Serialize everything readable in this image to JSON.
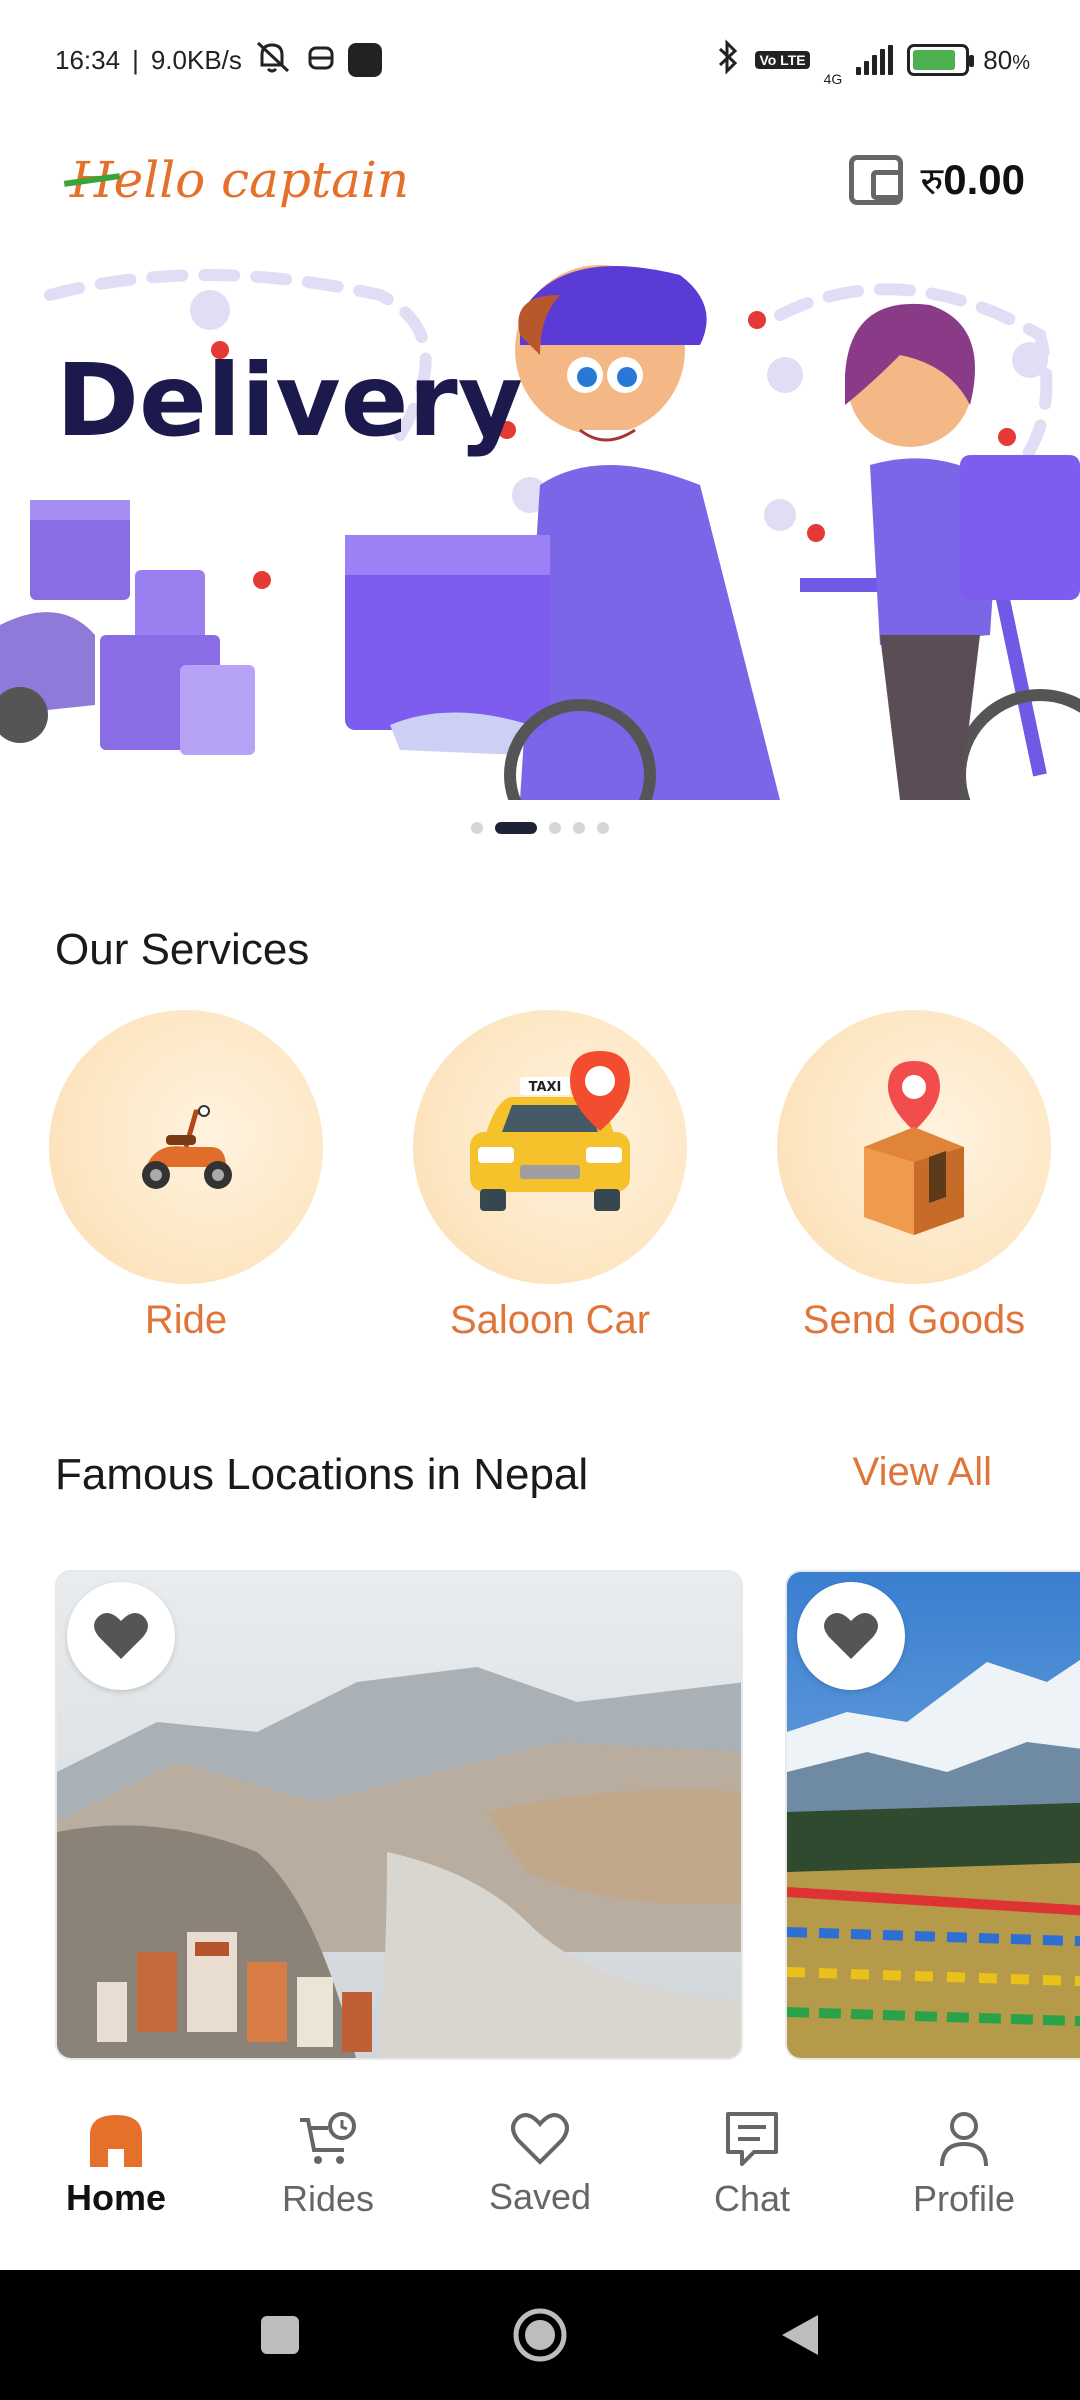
{
  "status_bar": {
    "time": "16:34",
    "net_speed": "9.0KB/s",
    "battery": "80",
    "network_type": "4G",
    "volte_label": "Vo LTE"
  },
  "header": {
    "logo_first": "H",
    "logo_rest": "ello captain",
    "currency": "रु",
    "wallet_amount": "0.00",
    "brand_color": "#e5702a"
  },
  "banner": {
    "headline": "Delivery",
    "active_index": 1,
    "slides": 5
  },
  "services": {
    "title": "Our Services",
    "items": [
      {
        "label": "Ride",
        "icon": "scooter-icon"
      },
      {
        "label": "Saloon Car",
        "icon": "taxi-icon"
      },
      {
        "label": "Send Goods",
        "icon": "parcel-icon"
      }
    ]
  },
  "locations": {
    "title": "Famous Locations in Nepal",
    "view_all": "View All",
    "cards": [
      {
        "image": "mustang-stupas",
        "favorite_icon": "heart-icon"
      },
      {
        "image": "himalaya-prayer-flags",
        "favorite_icon": "heart-icon"
      }
    ]
  },
  "bottom_nav": {
    "items": [
      {
        "label": "Home",
        "icon": "home-icon",
        "active": true
      },
      {
        "label": "Rides",
        "icon": "cart-clock-icon",
        "active": false
      },
      {
        "label": "Saved",
        "icon": "heart-icon",
        "active": false
      },
      {
        "label": "Chat",
        "icon": "chat-icon",
        "active": false
      },
      {
        "label": "Profile",
        "icon": "profile-icon",
        "active": false
      }
    ],
    "active_color": "#e5702a"
  }
}
